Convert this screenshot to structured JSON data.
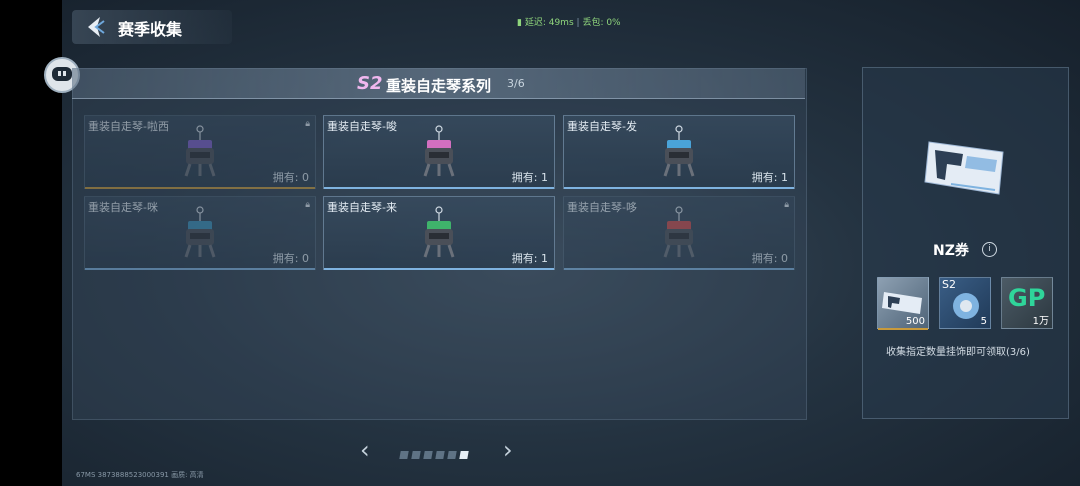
{
  "header": {
    "title": "赛季收集"
  },
  "net": {
    "latency": "延迟: 49ms",
    "packet_loss": "丢包: 0%"
  },
  "series": {
    "badge": "S2",
    "title": "重装自走琴系列",
    "count": "3/6"
  },
  "cards": [
    {
      "name": "重装自走琴-啦西",
      "owned": "拥有: 0",
      "locked": true,
      "accent": "#c89a3c",
      "robot_color": "#7b5fc8"
    },
    {
      "name": "重装自走琴-唆",
      "owned": "拥有: 1",
      "locked": false,
      "accent": "#7fb3e0",
      "robot_color": "#d36fc0"
    },
    {
      "name": "重装自走琴-发",
      "owned": "拥有: 1",
      "locked": false,
      "accent": "#7fb3e0",
      "robot_color": "#4aa3d8"
    },
    {
      "name": "重装自走琴-咪",
      "owned": "拥有: 0",
      "locked": true,
      "accent": "#7fb3e0",
      "robot_color": "#3b8fb8"
    },
    {
      "name": "重装自走琴-来",
      "owned": "拥有: 1",
      "locked": false,
      "accent": "#7fb3e0",
      "robot_color": "#3fb36b"
    },
    {
      "name": "重装自走琴-哆",
      "owned": "拥有: 0",
      "locked": true,
      "accent": "#7fb3e0",
      "robot_color": "#c84a4a"
    }
  ],
  "pagination": {
    "total": 6,
    "current": 6
  },
  "footer": {
    "text": "67MS  3873888523000391     画质: 高清"
  },
  "reward": {
    "name": "NZ券",
    "items": [
      {
        "label": "",
        "qty": "500",
        "accent": "#c89a3c",
        "icon": "ticket-icon"
      },
      {
        "label": "S2",
        "qty": "5",
        "accent": "#7fb3e0",
        "icon": "crate-icon"
      },
      {
        "label": "GP",
        "qty": "1万",
        "accent": "#7fb3e0",
        "icon": "gp-icon"
      }
    ],
    "description": "收集指定数量挂饰即可领取(3/6)"
  }
}
